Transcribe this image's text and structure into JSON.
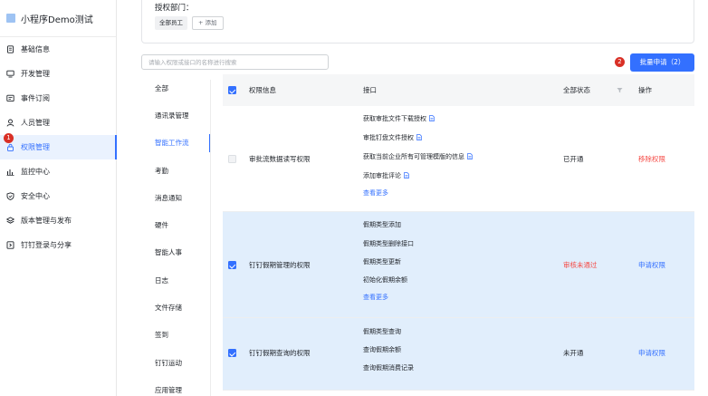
{
  "sidebar": {
    "app_name": "小程序Demo测试",
    "items": [
      {
        "label": "基础信息",
        "icon": "document-icon"
      },
      {
        "label": "开发管理",
        "icon": "monitor-icon"
      },
      {
        "label": "事件订阅",
        "icon": "message-icon"
      },
      {
        "label": "人员管理",
        "icon": "user-icon"
      },
      {
        "label": "权限管理",
        "icon": "lock-icon",
        "badge": "1"
      },
      {
        "label": "监控中心",
        "icon": "bar-chart-icon"
      },
      {
        "label": "安全中心",
        "icon": "shield-icon"
      },
      {
        "label": "版本管理与发布",
        "icon": "layers-icon"
      },
      {
        "label": "钉钉登录与分享",
        "icon": "login-icon"
      }
    ]
  },
  "auth": {
    "title": "授权部门：",
    "tag": "全部员工",
    "add_label": "+ 添加"
  },
  "search": {
    "placeholder": "请输入权限或接口的名称进行搜索"
  },
  "batch": {
    "badge": "2",
    "label": "批量申请（2）"
  },
  "categories": [
    "全部",
    "通讯录管理",
    "智能工作流",
    "考勤",
    "消息通知",
    "硬件",
    "智能人事",
    "日志",
    "文件存储",
    "签到",
    "钉钉运动",
    "应用管理"
  ],
  "table": {
    "headers": {
      "permission": "权限信息",
      "api": "接口",
      "status": "全部状态",
      "action": "操作"
    },
    "rows": [
      {
        "name": "审批流数据读写权限",
        "apis": [
          "获取审批文件下载授权",
          "审批钉盘文件授权",
          "获取当前企业所有可管理模版的信息",
          "添加审批评论"
        ],
        "more": "查看更多",
        "status": "已开通",
        "action": "移除权限"
      },
      {
        "name": "钉钉假期管理的权限",
        "apis": [
          "假期类型添加",
          "假期类型删除接口",
          "假期类型更新",
          "初始化假期余额"
        ],
        "more": "查看更多",
        "status": "审核未通过",
        "action": "申请权限"
      },
      {
        "name": "钉钉假期查询的权限",
        "apis": [
          "假期类型查询",
          "查询假期余额",
          "查询假期消费记录"
        ],
        "status": "未开通",
        "action": "申请权限"
      }
    ]
  },
  "colors": {
    "primary": "#3370ff",
    "danger": "#f54a45",
    "selected_row": "#e1eefc"
  }
}
